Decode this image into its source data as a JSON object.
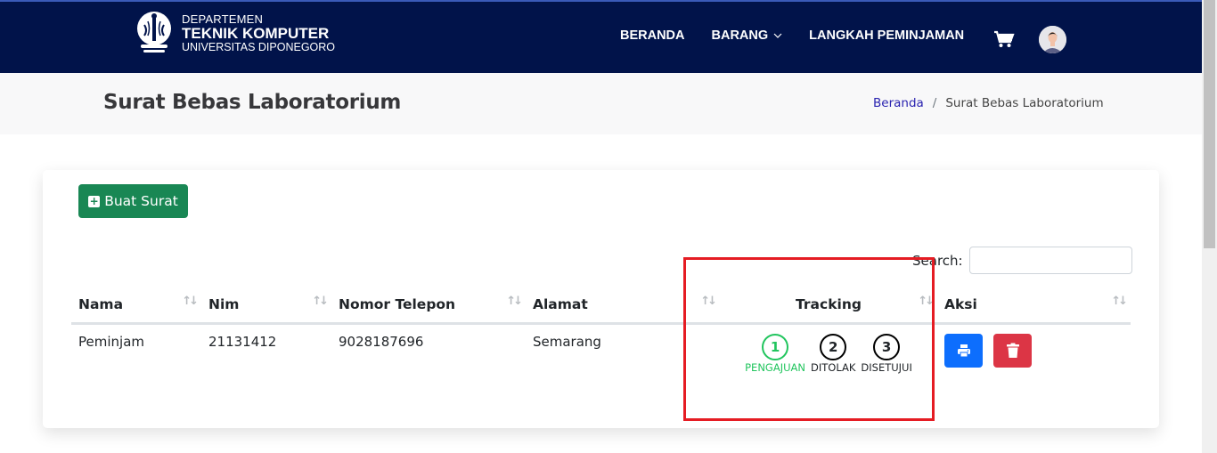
{
  "brand": {
    "line1": "DEPARTEMEN",
    "line2": "TEKNIK KOMPUTER",
    "line3": "UNIVERSITAS DIPONEGORO"
  },
  "nav": {
    "items": [
      {
        "label": "BERANDA"
      },
      {
        "label": "BARANG",
        "has_dropdown": true
      },
      {
        "label": "LANGKAH PEMINJAMAN"
      }
    ],
    "cart_icon": "shopping-cart-icon",
    "avatar_icon": "user-avatar"
  },
  "header": {
    "title": "Surat Bebas Laboratorium",
    "breadcrumb": [
      {
        "label": "Beranda",
        "link": true
      },
      {
        "label": "Surat Bebas Laboratorium",
        "link": false
      }
    ],
    "separator": "/"
  },
  "toolbar": {
    "create_label": "Buat Surat",
    "create_icon": "plus-square-icon",
    "search_label": "Search:",
    "search_value": ""
  },
  "table": {
    "columns": [
      "Nama",
      "Nim",
      "Nomor Telepon",
      "Alamat",
      "Tracking",
      "Aksi"
    ],
    "sort_glyph": "↑↓",
    "rows": [
      {
        "nama": "Peminjam",
        "nim": "21131412",
        "telepon": "9028187696",
        "alamat": "Semarang",
        "tracking": [
          {
            "num": "1",
            "label": "PENGAJUAN",
            "active": true
          },
          {
            "num": "2",
            "label": "DITOLAK",
            "active": false
          },
          {
            "num": "3",
            "label": "DISETUJUI",
            "active": false
          }
        ],
        "actions": [
          "print",
          "delete"
        ]
      }
    ]
  },
  "colors": {
    "navbar": "#01134a",
    "create_button": "#198754",
    "print_button": "#0d6efd",
    "delete_button": "#dc3545",
    "tracking_active": "#22c55e",
    "highlight": "#e51c23"
  }
}
